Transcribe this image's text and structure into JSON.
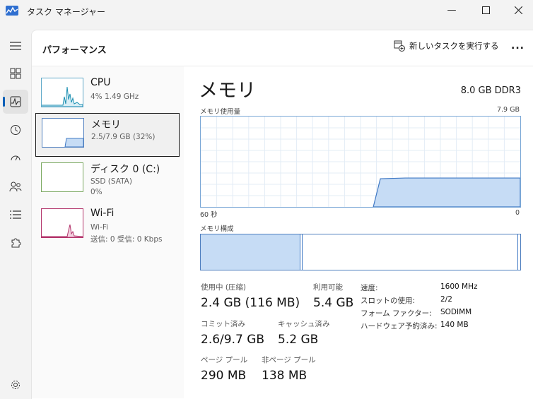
{
  "window": {
    "title": "タスク マネージャー"
  },
  "header": {
    "title": "パフォーマンス",
    "run_task_label": "新しいタスクを実行する",
    "more_label": "..."
  },
  "sidebar": {
    "items": [
      {
        "name": "CPU",
        "line1": "4% 1.49 GHz",
        "line2": ""
      },
      {
        "name": "メモリ",
        "line1": "2.5/7.9 GB (32%)",
        "line2": ""
      },
      {
        "name": "ディスク 0 (C:)",
        "line1": "SSD (SATA)",
        "line2": "0%"
      },
      {
        "name": "Wi-Fi",
        "line1": "Wi-Fi",
        "line2": "送信: 0 受信: 0 Kbps"
      }
    ]
  },
  "memory": {
    "title": "メモリ",
    "spec": "8.0 GB DDR3",
    "usage_label": "メモリ使用量",
    "usage_max": "7.9 GB",
    "time_left": "60 秒",
    "time_right": "0",
    "composition_label": "メモリ構成",
    "in_use_label": "使用中 (圧縮)",
    "in_use_value": "2.4 GB (116 MB)",
    "available_label": "利用可能",
    "available_value": "5.4 GB",
    "committed_label": "コミット済み",
    "committed_value": "2.6/9.7 GB",
    "cached_label": "キャッシュ済み",
    "cached_value": "5.2 GB",
    "paged_label": "ページ プール",
    "paged_value": "290 MB",
    "nonpaged_label": "非ページ プール",
    "nonpaged_value": "138 MB",
    "speed_label": "速度:",
    "speed_value": "1600 MHz",
    "slots_label": "スロットの使用:",
    "slots_value": "2/2",
    "form_label": "フォーム ファクター:",
    "form_value": "SODIMM",
    "reserved_label": "ハードウェア予約済み:",
    "reserved_value": "140 MB",
    "usage_fraction": 0.32,
    "composition_in_use_fraction": 0.31
  },
  "colors": {
    "accent": "#005fb8",
    "memory_fill": "#c6dcf5",
    "memory_line": "#3f78c4",
    "cpu_line": "#1b8fb1",
    "wifi_line": "#b3346b"
  }
}
